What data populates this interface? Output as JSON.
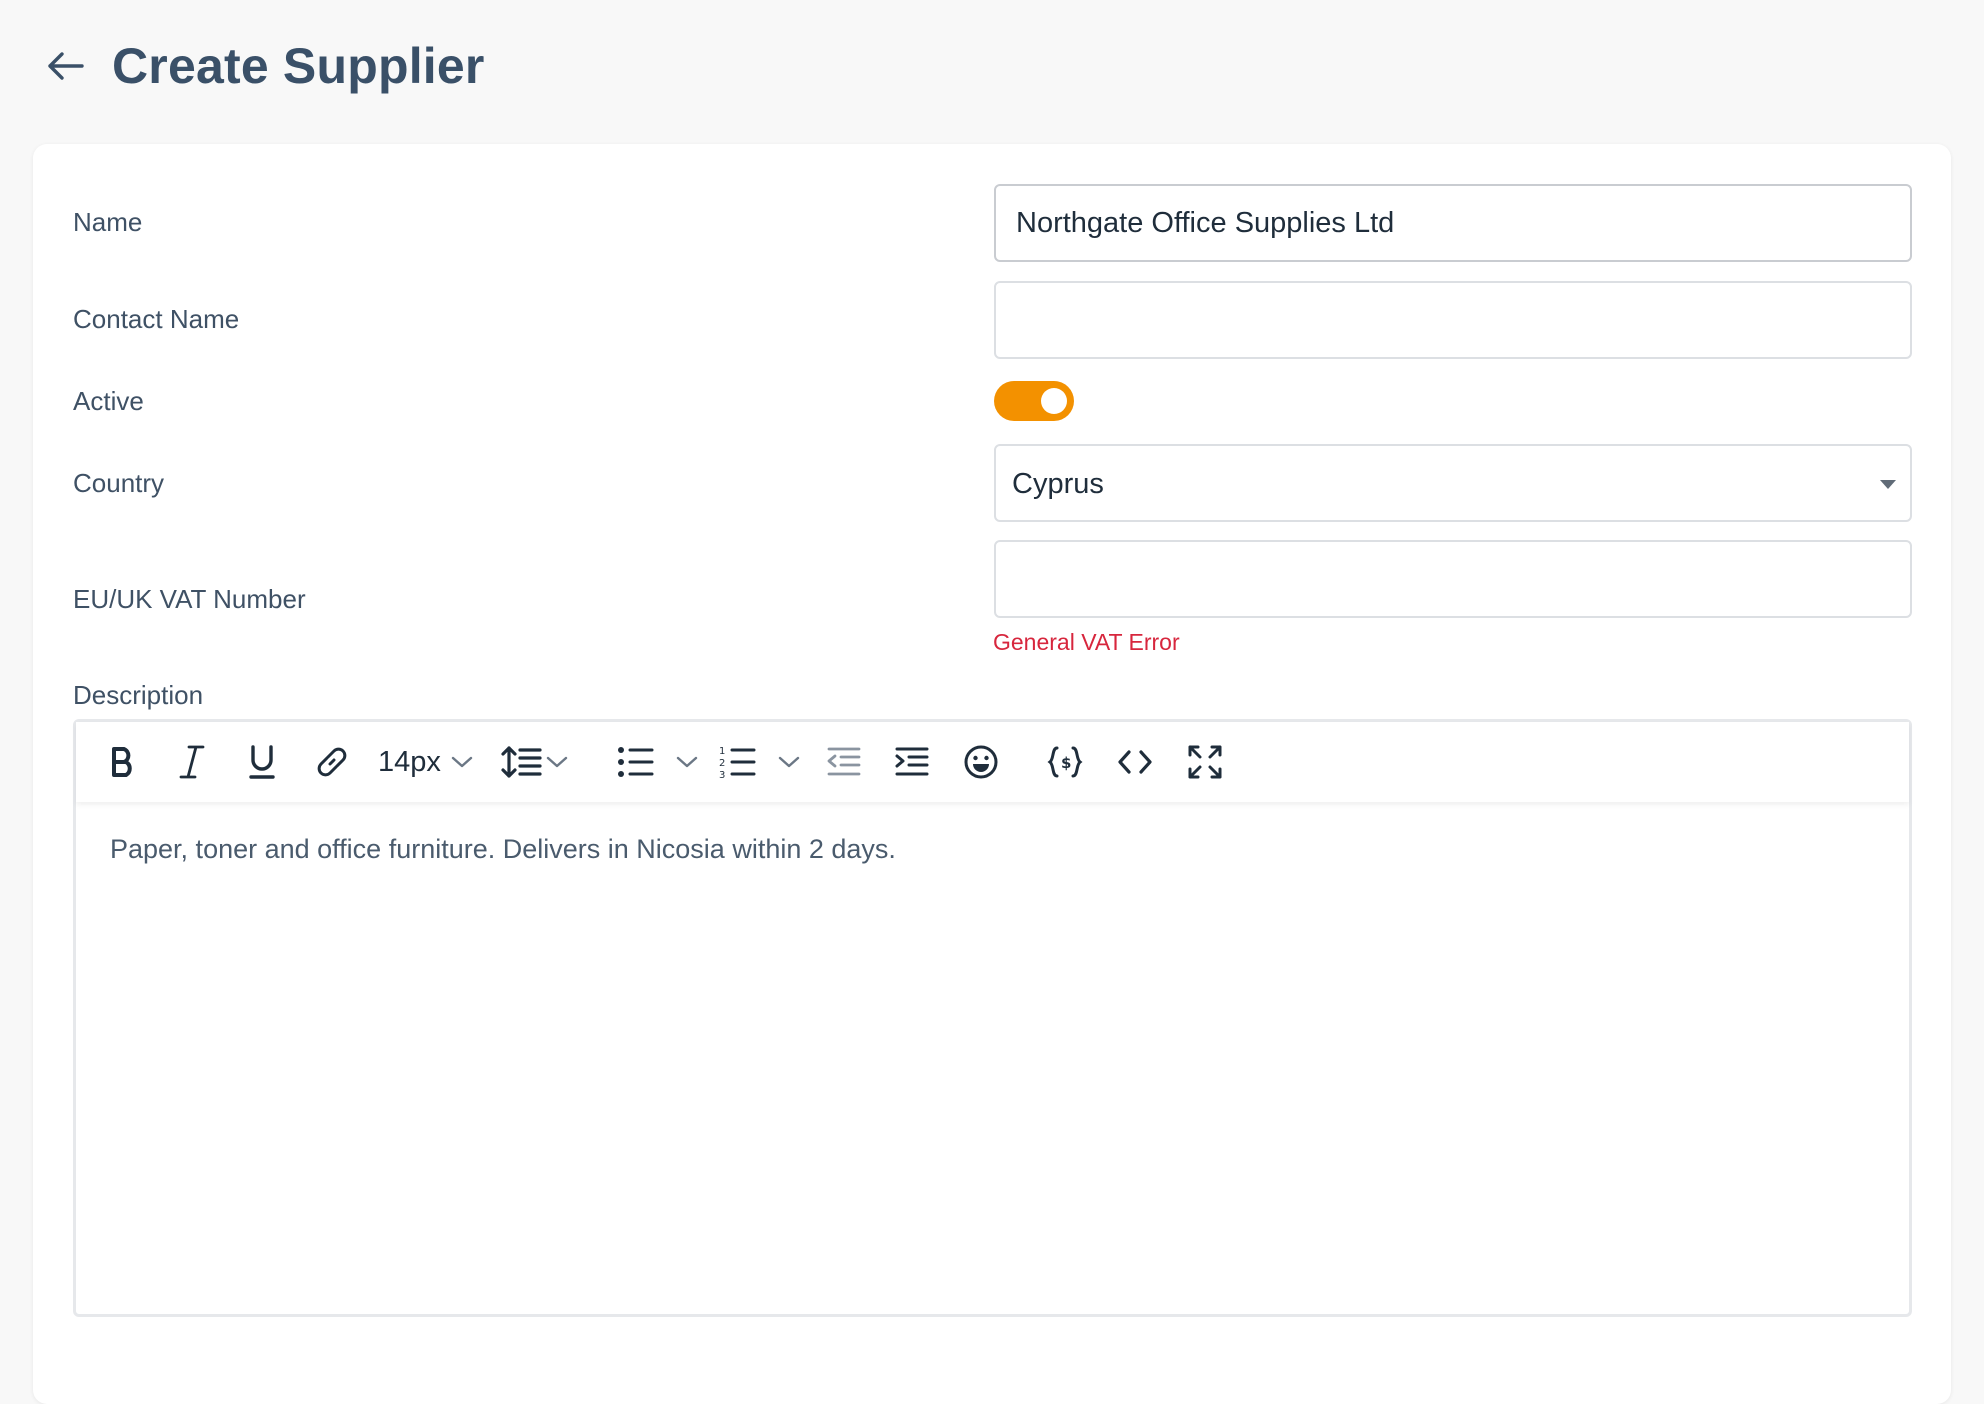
{
  "header": {
    "title": "Create Supplier",
    "back_icon": "arrow-left-icon"
  },
  "form": {
    "name": {
      "label": "Name",
      "value": "Northgate Office Supplies Ltd"
    },
    "contact_name": {
      "label": "Contact Name",
      "value": ""
    },
    "active": {
      "label": "Active",
      "checked": true,
      "on_color": "#f39100"
    },
    "country": {
      "label": "Country",
      "value": "Cyprus"
    },
    "vat_number": {
      "label": "EU/UK VAT Number",
      "value": "",
      "error": "General VAT Error",
      "error_color": "#d7263d"
    },
    "description": {
      "label": "Description",
      "content": "Paper, toner and office furniture. Delivers in Nicosia within 2 days.",
      "toolbar": {
        "font_size": "14px",
        "buttons": [
          "bold-icon",
          "italic-icon",
          "underline-icon",
          "link-icon",
          "font-size-select",
          "line-height-icon",
          "bullet-list-icon",
          "numbered-list-icon",
          "outdent-icon",
          "indent-icon",
          "emoji-icon",
          "variables-icon",
          "code-view-icon",
          "fullscreen-icon"
        ]
      }
    }
  },
  "colors": {
    "accent": "#f39100",
    "title": "#3a5068",
    "error": "#d7263d"
  }
}
